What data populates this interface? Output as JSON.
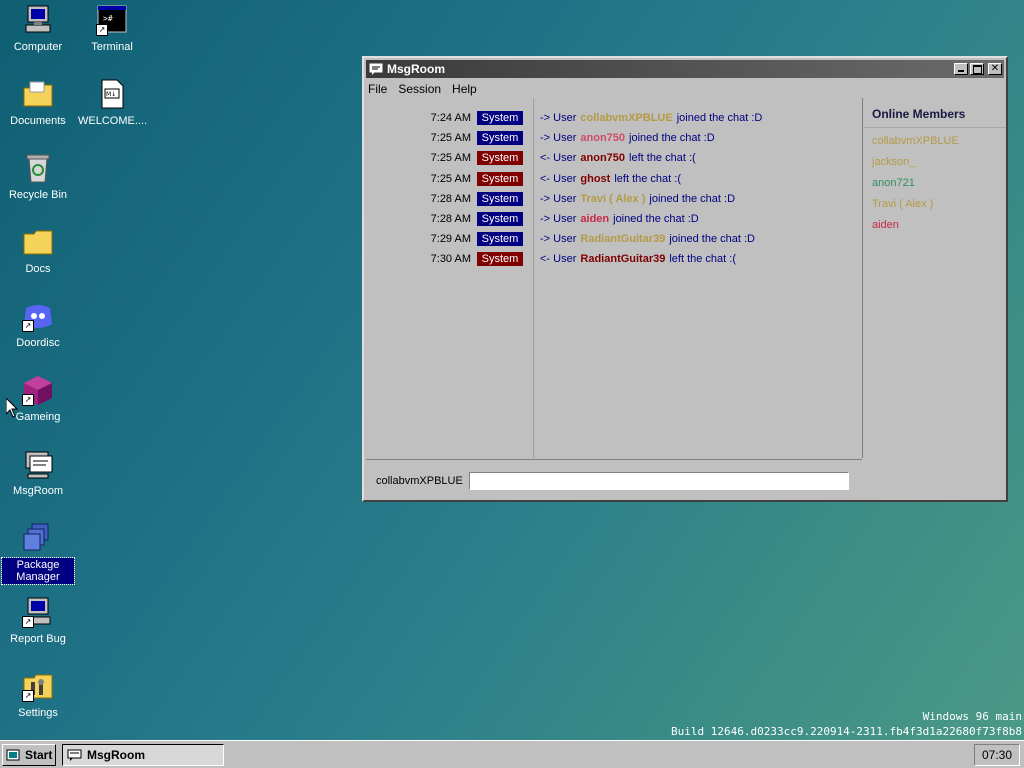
{
  "desktop": {
    "icons": [
      {
        "label": "Computer",
        "icon": "computer-icon"
      },
      {
        "label": "Terminal",
        "icon": "terminal-icon"
      },
      {
        "label": "Documents",
        "icon": "documents-folder-icon"
      },
      {
        "label": "WELCOME....",
        "icon": "markdown-file-icon"
      },
      {
        "label": "Recycle Bin",
        "icon": "recycle-bin-icon"
      },
      {
        "label": "Docs",
        "icon": "folder-icon"
      },
      {
        "label": "Doordisc",
        "icon": "doordisc-icon"
      },
      {
        "label": "Gameing",
        "icon": "game-cube-icon"
      },
      {
        "label": "MsgRoom",
        "icon": "msgroom-icon"
      },
      {
        "label": "Package Manager",
        "icon": "package-icon"
      },
      {
        "label": "Report Bug",
        "icon": "report-bug-icon"
      },
      {
        "label": "Settings",
        "icon": "settings-icon"
      }
    ]
  },
  "window": {
    "title": "MsgRoom",
    "menu": [
      "File",
      "Session",
      "Help"
    ],
    "messages": [
      {
        "time": "7:24 AM",
        "sender": "System",
        "badge_color": "#000080",
        "arrow": "->",
        "pre": "User",
        "user": "collabvmXPBLUE",
        "user_color": "#b39b45",
        "post": "joined the chat :D"
      },
      {
        "time": "7:25 AM",
        "sender": "System",
        "badge_color": "#000080",
        "arrow": "->",
        "pre": "User",
        "user": "anon750",
        "user_color": "#d04a6a",
        "post": "joined the chat :D"
      },
      {
        "time": "7:25 AM",
        "sender": "System",
        "badge_color": "#800000",
        "arrow": "<-",
        "pre": "User",
        "user": "anon750",
        "user_color": "#800000",
        "post": "left the chat :("
      },
      {
        "time": "7:25 AM",
        "sender": "System",
        "badge_color": "#800000",
        "arrow": "<-",
        "pre": "User",
        "user": "ghost",
        "user_color": "#800000",
        "post": "left the chat :("
      },
      {
        "time": "7:28 AM",
        "sender": "System",
        "badge_color": "#000080",
        "arrow": "->",
        "pre": "User",
        "user": "Travi  ( Alex )",
        "user_color": "#b39b45",
        "post": "joined the chat :D"
      },
      {
        "time": "7:28 AM",
        "sender": "System",
        "badge_color": "#000080",
        "arrow": "->",
        "pre": "User",
        "user": "aiden",
        "user_color": "#c8284a",
        "post": "joined the chat :D"
      },
      {
        "time": "7:29 AM",
        "sender": "System",
        "badge_color": "#000080",
        "arrow": "->",
        "pre": "User",
        "user": "RadiantGuitar39",
        "user_color": "#b39b45",
        "post": "joined the chat :D"
      },
      {
        "time": "7:30 AM",
        "sender": "System",
        "badge_color": "#800000",
        "arrow": "<-",
        "pre": "User",
        "user": "RadiantGuitar39",
        "user_color": "#800000",
        "post": "left the chat :("
      }
    ],
    "members_title": "Online Members",
    "members": [
      {
        "name": "collabvmXPBLUE",
        "color": "#b39b45"
      },
      {
        "name": "jackson_",
        "color": "#b39b45"
      },
      {
        "name": "anon721",
        "color": "#2f8f5f"
      },
      {
        "name": "Travi ( Alex )",
        "color": "#b39b45"
      },
      {
        "name": "aiden",
        "color": "#c8284a"
      }
    ],
    "nickname": "collabvmXPBLUE",
    "input_value": ""
  },
  "build": {
    "line1": "Windows 96 main",
    "line2": "Build 12646.d0233cc9.220914-2311.fb4f3d1a22680f73f8b8"
  },
  "taskbar": {
    "start_label": "Start",
    "task_label": "MsgRoom",
    "clock": "07:30"
  }
}
